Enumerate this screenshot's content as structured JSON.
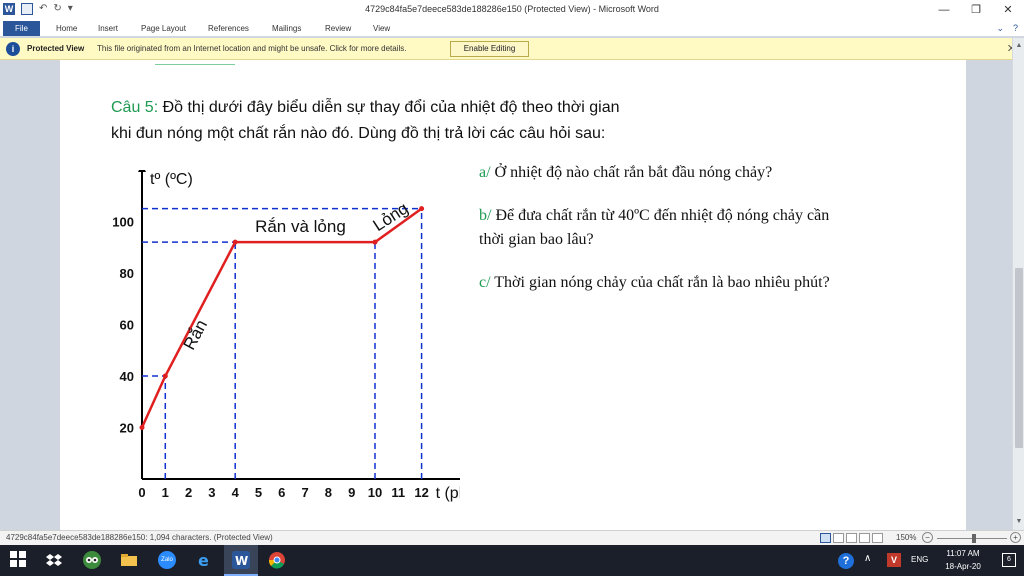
{
  "window": {
    "title": "4729c84fa5e7deece583de188286e150 (Protected View)  -  Microsoft Word",
    "app_icon": "W",
    "controls": [
      "—",
      "❐",
      "✕"
    ]
  },
  "ribbon": {
    "tabs": [
      "File",
      "Home",
      "Insert",
      "Page Layout",
      "References",
      "Mailings",
      "Review",
      "View"
    ],
    "help_icons": [
      "⌄",
      "?"
    ]
  },
  "protected_view": {
    "title": "Protected View",
    "message": "This file originated from an Internet location and might be unsafe. Click for more details.",
    "button": "Enable Editing",
    "close": "✕"
  },
  "document": {
    "question_label": "Câu 5:",
    "question_line1": " Đồ thị dưới đây biểu diễn sự thay đổi của nhiệt độ theo thời gian",
    "question_line2": "khi đun nóng một chất rắn nào đó. Dùng đồ thị trả lời các câu hỏi sau:",
    "items": [
      {
        "label": "a/",
        "text": " Ở nhiệt độ nào chất rắn bắt đầu nóng chảy?"
      },
      {
        "label": "b/",
        "text": " Để đưa chất rắn từ 40ºC đến nhiệt độ nóng chảy cần",
        "text2": "thời gian bao lâu?"
      },
      {
        "label": "c/",
        "text": " Thời gian nóng chảy của chất rắn là bao nhiêu phút?"
      }
    ]
  },
  "chart_data": {
    "type": "line",
    "xlabel": "t (phút)",
    "ylabel": "tº (ºC)",
    "x_ticks": [
      "0",
      "1",
      "2",
      "3",
      "4",
      "5",
      "6",
      "7",
      "8",
      "9",
      "10",
      "11",
      "12"
    ],
    "y_ticks": [
      "20",
      "40",
      "60",
      "80",
      "100"
    ],
    "xlim": [
      0,
      14.5
    ],
    "ylim": [
      0,
      120
    ],
    "points": [
      {
        "x": 0,
        "y": 20
      },
      {
        "x": 1,
        "y": 40
      },
      {
        "x": 4,
        "y": 92
      },
      {
        "x": 10,
        "y": 92
      },
      {
        "x": 12,
        "y": 105
      }
    ],
    "guide_x": [
      1,
      4,
      10,
      12
    ],
    "guide_y": [
      40,
      92,
      105
    ],
    "annotations": [
      {
        "text": "Rắn",
        "x": 2.5,
        "y": 55,
        "angle": -62
      },
      {
        "text": "Rắn và lỏng",
        "x": 6.8,
        "y": 96
      },
      {
        "text": "Lỏng",
        "x": 10.8,
        "y": 100,
        "angle": -33
      }
    ],
    "line_color": "#e02020",
    "guide_color": "#1030d0"
  },
  "statusbar": {
    "text": "4729c84fa5e7deece583de188286e150: 1,094 characters.  (Protected View)",
    "zoom": "150%",
    "zoom_minus": "−",
    "zoom_plus": "+"
  },
  "taskbar": {
    "apps": [
      "dropbox-icon",
      "tripadvisor-icon",
      "file-explorer-icon",
      "zalo-icon",
      "edge-icon",
      "word-icon",
      "chrome-icon"
    ],
    "zalo_label": "Zalo",
    "help": "?",
    "chevron": "∧",
    "tray_v": "V",
    "language": "ENG",
    "time": "11:07 AM",
    "date": "18-Apr-20",
    "notifications": "6"
  },
  "colors": {
    "word_blue": "#2b579a",
    "question_label_green": "#1e9a52",
    "protected_bar": "#fff9c4"
  }
}
